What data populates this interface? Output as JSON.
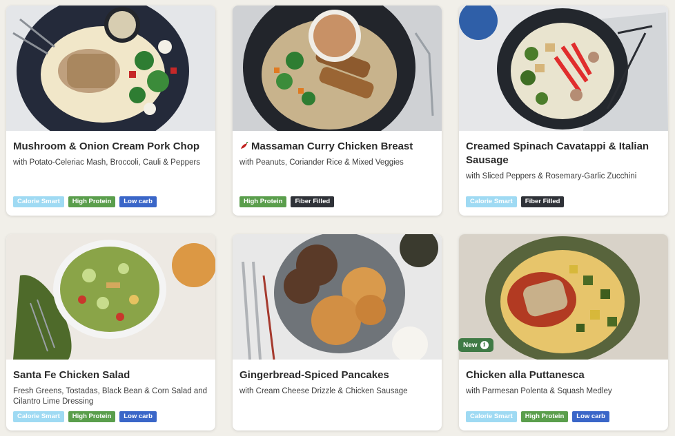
{
  "meals": [
    {
      "title": "Mushroom & Onion Cream Pork Chop",
      "subtitle": "with Potato-Celeriac Mash, Broccoli, Cauli & Peppers",
      "spicy": false,
      "tags": [
        "Calorie Smart",
        "High Protein",
        "Low carb"
      ]
    },
    {
      "title": "Massaman Curry Chicken Breast",
      "subtitle": "with Peanuts, Coriander Rice & Mixed Veggies",
      "spicy": true,
      "tags": [
        "High Protein",
        "Fiber Filled"
      ]
    },
    {
      "title": "Creamed Spinach Cavatappi & Italian Sausage",
      "subtitle": "with Sliced Peppers & Rosemary-Garlic Zucchini",
      "spicy": false,
      "tags": [
        "Calorie Smart",
        "Fiber Filled"
      ]
    },
    {
      "title": "Santa Fe Chicken Salad",
      "subtitle": "Fresh Greens, Tostadas, Black Bean & Corn Salad and Cilantro Lime Dressing",
      "spicy": false,
      "tags": [
        "Calorie Smart",
        "High Protein",
        "Low carb"
      ]
    },
    {
      "title": "Gingerbread-Spiced Pancakes",
      "subtitle": "with Cream Cheese Drizzle & Chicken Sausage",
      "spicy": false,
      "tags": []
    },
    {
      "title": "Chicken alla Puttanesca",
      "subtitle": "with Parmesan Polenta & Squash Medley",
      "spicy": false,
      "new_badge": "New",
      "tags": [
        "Calorie Smart",
        "High Protein",
        "Low carb"
      ]
    }
  ],
  "colors": {
    "calorie_smart": "#9fdaf3",
    "high_protein": "#5a9e4c",
    "low_carb": "#3a66c8",
    "fiber_filled": "#2f3238",
    "new_badge": "#3f7a45"
  },
  "icons": {
    "spicy": "chili-pepper-icon",
    "info": "info-icon"
  }
}
